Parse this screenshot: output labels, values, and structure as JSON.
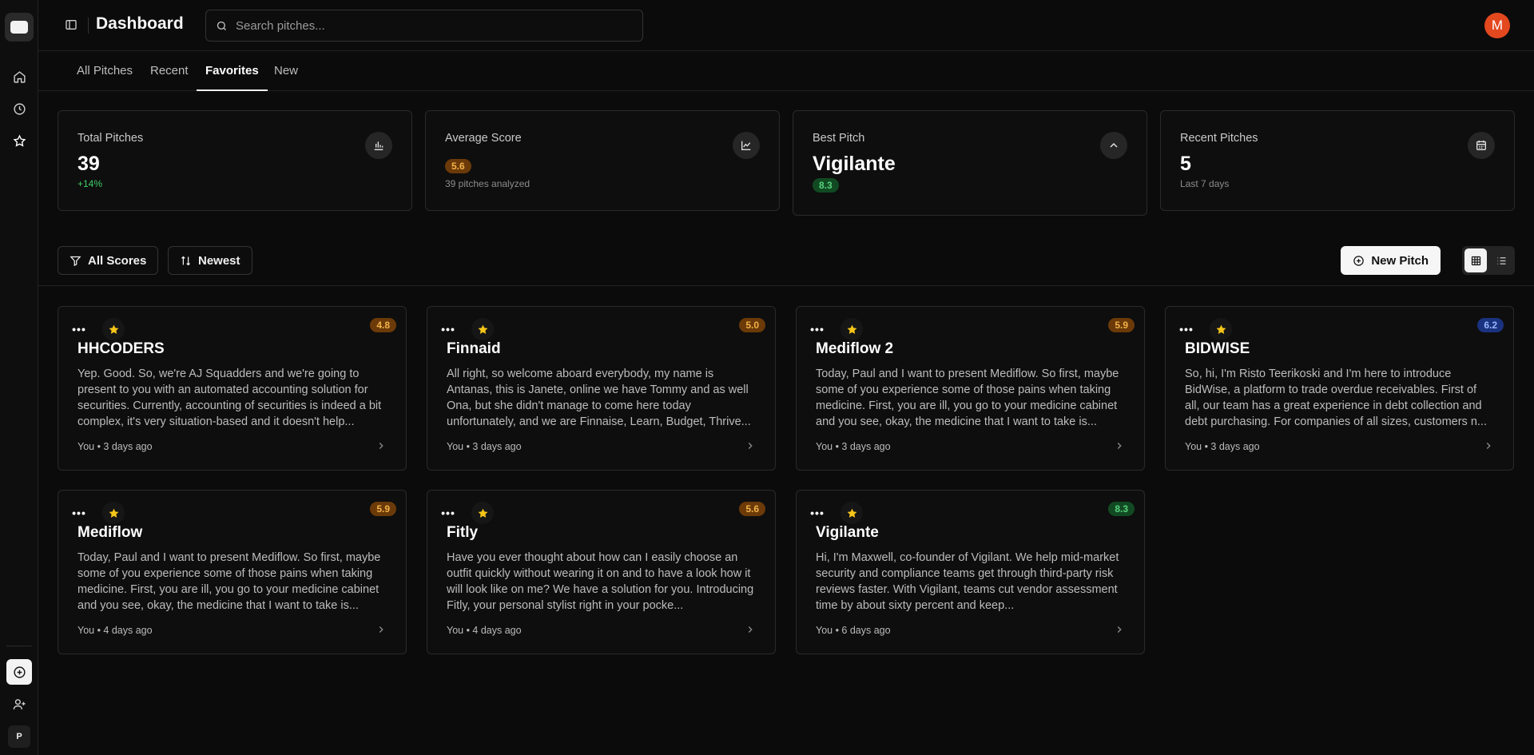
{
  "app": {
    "title": "Dashboard"
  },
  "search": {
    "placeholder": "Search pitches..."
  },
  "user": {
    "initial": "M",
    "color": "#e4481f"
  },
  "rail": {
    "workspace_initial": "P"
  },
  "tabs": [
    {
      "label": "All Pitches",
      "active": false
    },
    {
      "label": "Recent",
      "active": false
    },
    {
      "label": "Favorites",
      "active": true
    },
    {
      "label": "New",
      "active": false
    }
  ],
  "stats": [
    {
      "label": "Total Pitches",
      "value": "39",
      "sub": "+14%",
      "icon": "bar-chart-icon"
    },
    {
      "label": "Average Score",
      "badge": "5.6",
      "sub": "39 pitches analyzed",
      "icon": "line-chart-icon"
    },
    {
      "label": "Best Pitch",
      "value": "Vigilante",
      "badge": "8.3",
      "icon": "chevron-up-icon"
    },
    {
      "label": "Recent Pitches",
      "value": "5",
      "sub": "Last 7 days",
      "icon": "calendar-icon"
    }
  ],
  "toolbar": {
    "filter_label": "All Scores",
    "sort_label": "Newest",
    "new_label": "New Pitch"
  },
  "pitches": [
    {
      "title": "HHCODERS",
      "score": "4.8",
      "color": "amber",
      "meta": "You • 3 days ago",
      "text": "Yep. Good. So, we're AJ Squadders and we're going to present to you with an automated accounting solution for securities. Currently, accounting of securities is indeed a bit complex, it's very situation-based and it doesn't help..."
    },
    {
      "title": "Finnaid",
      "score": "5.0",
      "color": "amber",
      "meta": "You • 3 days ago",
      "text": "All right, so welcome aboard everybody, my name is Antanas, this is Janete, online we have Tommy and as well Ona, but she didn't manage to come here today unfortunately, and we are Finnaise, Learn, Budget, Thrive..."
    },
    {
      "title": "Mediflow 2",
      "score": "5.9",
      "color": "amber",
      "meta": "You • 3 days ago",
      "text": "Today, Paul and I want to present Mediflow. So first, maybe some of you experience some of those pains when taking medicine. First, you are ill, you go to your medicine cabinet and you see, okay, the medicine that I want to take is..."
    },
    {
      "title": "BIDWISE",
      "score": "6.2",
      "color": "blue",
      "meta": "You • 3 days ago",
      "text": "So, hi, I'm Risto Teerikoski and I'm here to introduce BidWise, a platform to trade overdue receivables. First of all, our team has a great experience in debt collection and debt purchasing. For companies of all sizes, customers n..."
    },
    {
      "title": "Mediflow",
      "score": "5.9",
      "color": "amber",
      "meta": "You • 4 days ago",
      "text": "Today, Paul and I want to present Mediflow. So first, maybe some of you experience some of those pains when taking medicine. First, you are ill, you go to your medicine cabinet and you see, okay, the medicine that I want to take is..."
    },
    {
      "title": "Fitly",
      "score": "5.6",
      "color": "amber",
      "meta": "You • 4 days ago",
      "text": "Have you ever thought about how can I easily choose an outfit quickly without wearing it on and to have a look how it will look like on me? We have a solution for you. Introducing Fitly, your personal stylist right in your pocke..."
    },
    {
      "title": "Vigilante",
      "score": "8.3",
      "color": "green",
      "meta": "You • 6 days ago",
      "text": "Hi, I'm Maxwell, co-founder of Vigilant. We help mid-market security and compliance teams get through third-party risk reviews faster. With Vigilant, teams cut vendor assessment time by about sixty percent and keep..."
    }
  ]
}
